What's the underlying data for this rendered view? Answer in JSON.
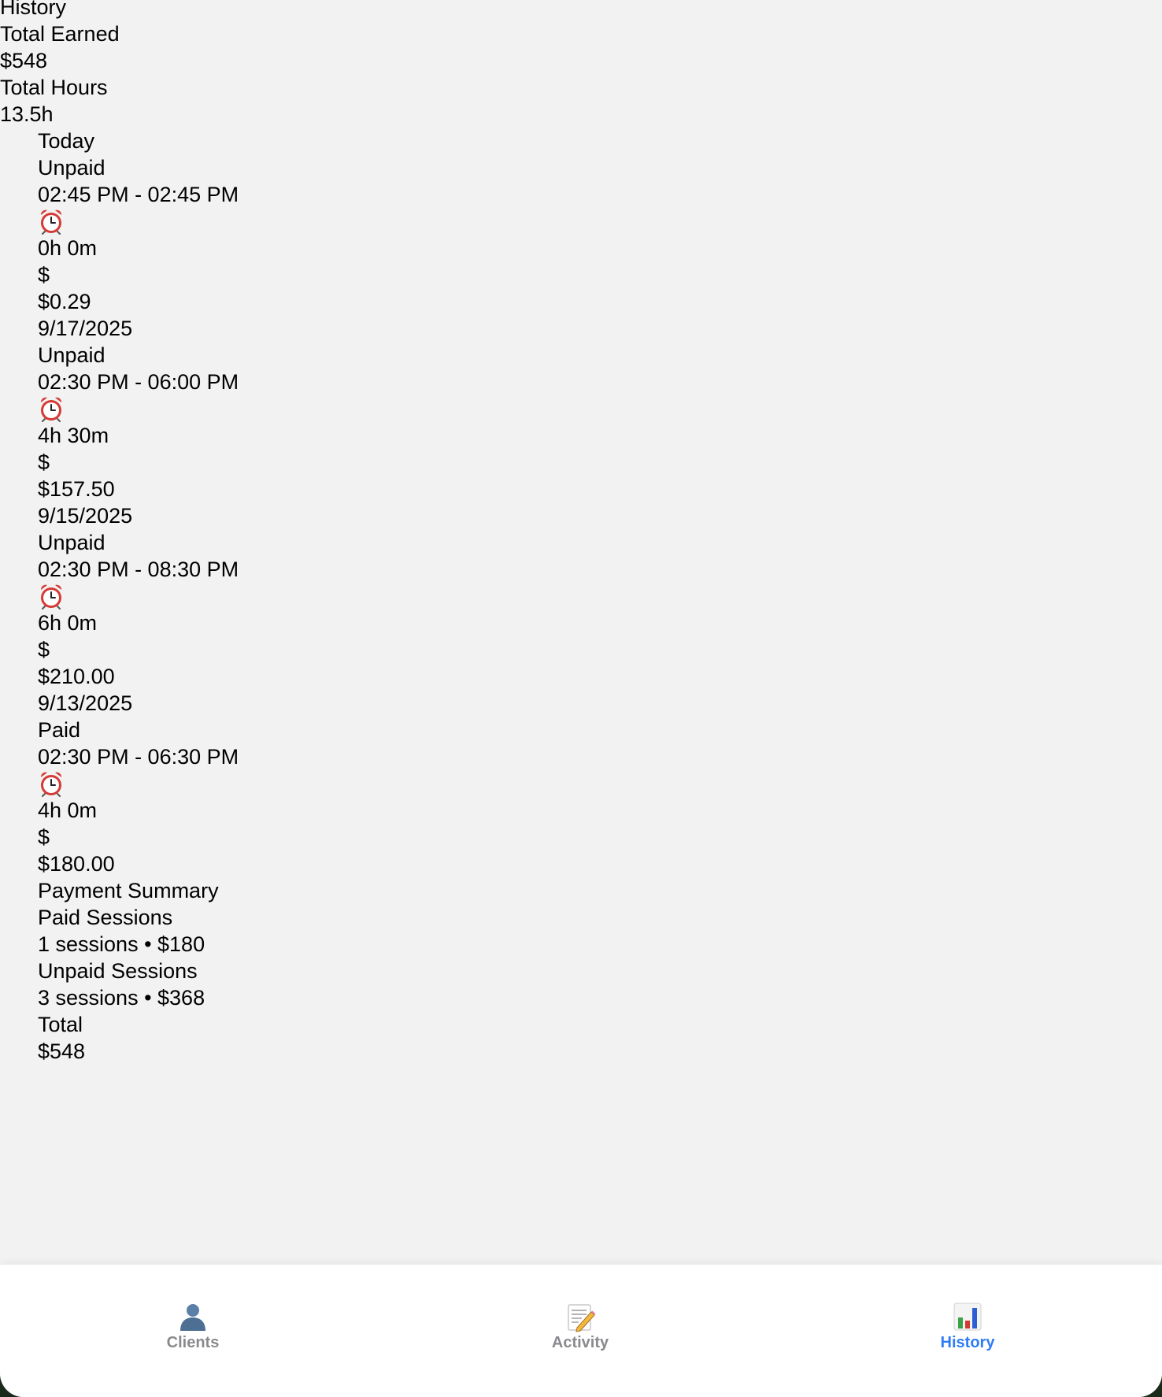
{
  "header": {
    "title": "History",
    "total_earned_label": "Total Earned",
    "total_earned_value": "$548",
    "total_hours_label": "Total Hours",
    "total_hours_value": "13.5h"
  },
  "sessions": [
    {
      "date": "Today",
      "status": "Unpaid",
      "time_range": "02:45 PM - 02:45 PM",
      "duration_icon": "alarm-clock-icon",
      "duration": "0h 0m",
      "amount_icon_text": "$",
      "amount": "$0.29"
    },
    {
      "date": "9/17/2025",
      "status": "Unpaid",
      "time_range": "02:30 PM - 06:00 PM",
      "duration_icon": "alarm-clock-icon",
      "duration": "4h 30m",
      "amount_icon_text": "$",
      "amount": "$157.50"
    },
    {
      "date": "9/15/2025",
      "status": "Unpaid",
      "time_range": "02:30 PM - 08:30 PM",
      "duration_icon": "alarm-clock-icon",
      "duration": "6h 0m",
      "amount_icon_text": "$",
      "amount": "$210.00"
    },
    {
      "date": "9/13/2025",
      "status": "Paid",
      "time_range": "02:30 PM - 06:30 PM",
      "duration_icon": "alarm-clock-icon",
      "duration": "4h 0m",
      "amount_icon_text": "$",
      "amount": "$180.00"
    }
  ],
  "payment_summary": {
    "title": "Payment Summary",
    "paid_label": "Paid Sessions",
    "paid_value": "1 sessions • $180",
    "unpaid_label": "Unpaid Sessions",
    "unpaid_value": "3 sessions • $368",
    "total_label": "Total",
    "total_value": "$548"
  },
  "tabbar": {
    "active_color": "#2f7cf6",
    "inactive_color": "#8a8a8e",
    "tabs": [
      {
        "label": "Clients",
        "icon": "person-silhouette-icon",
        "active": false
      },
      {
        "label": "Activity",
        "icon": "memo-pencil-icon",
        "active": false
      },
      {
        "label": "History",
        "icon": "bar-chart-icon",
        "active": true
      }
    ]
  }
}
